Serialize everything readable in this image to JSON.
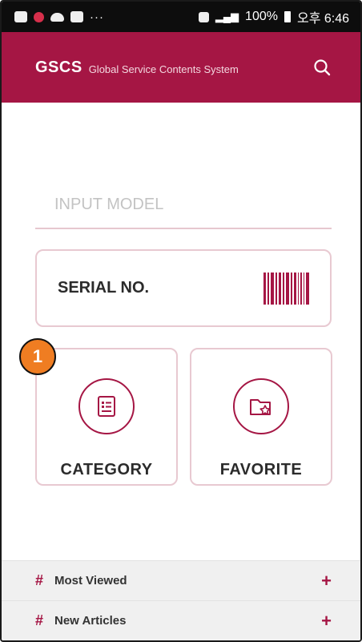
{
  "status_bar": {
    "dots": "···",
    "battery": "100%",
    "time": "오후 6:46"
  },
  "header": {
    "brand": "GSCS",
    "subtitle": "Global Service Contents System",
    "search_icon": "search-icon"
  },
  "model_input": {
    "placeholder": "INPUT MODEL",
    "value": ""
  },
  "serial": {
    "label": "SERIAL NO.",
    "icon": "barcode-icon"
  },
  "tiles": [
    {
      "label": "CATEGORY",
      "icon": "list-document-icon"
    },
    {
      "label": "FAVORITE",
      "icon": "folder-star-icon"
    }
  ],
  "badge": {
    "number": "1"
  },
  "bottom_list": [
    {
      "hash": "#",
      "label": "Most Viewed",
      "action": "+"
    },
    {
      "hash": "#",
      "label": "New Articles",
      "action": "+"
    }
  ],
  "colors": {
    "accent": "#a51644",
    "border": "#e8c9d1",
    "badge": "#ef7d22"
  }
}
